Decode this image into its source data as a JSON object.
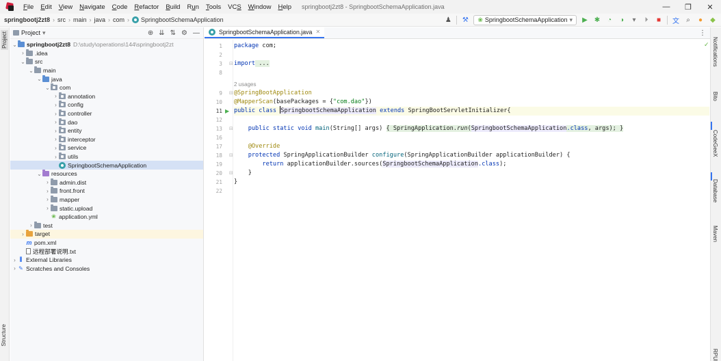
{
  "menubar": {
    "items": [
      {
        "label": "File",
        "u": "F"
      },
      {
        "label": "Edit",
        "u": "E"
      },
      {
        "label": "View",
        "u": "V"
      },
      {
        "label": "Navigate",
        "u": "N"
      },
      {
        "label": "Code",
        "u": "C"
      },
      {
        "label": "Refactor",
        "u": "R"
      },
      {
        "label": "Build",
        "u": "B"
      },
      {
        "label": "Run",
        "u": "u"
      },
      {
        "label": "Tools",
        "u": "T"
      },
      {
        "label": "VCS",
        "u": "S"
      },
      {
        "label": "Window",
        "u": "W"
      },
      {
        "label": "Help",
        "u": "H"
      }
    ],
    "window_title": "springbootj2zt8 - SpringbootSchemaApplication.java",
    "controls": {
      "minimize": "—",
      "maximize": "❐",
      "close": "✕"
    }
  },
  "navbar": {
    "crumbs": [
      "springbootj2zt8",
      "src",
      "main",
      "java",
      "com",
      "SpringbootSchemaApplication"
    ],
    "run_config": "SpringbootSchemaApplication"
  },
  "project_panel": {
    "title": "Project",
    "tree": [
      {
        "level": 0,
        "chev": "⌄",
        "icon": "mod",
        "label": "springbootj2zt8",
        "bold": true,
        "path": "D:\\study\\operations\\144\\springbootj2zt"
      },
      {
        "level": 1,
        "chev": "›",
        "icon": "plain",
        "label": ".idea"
      },
      {
        "level": 1,
        "chev": "⌄",
        "icon": "plain",
        "label": "src"
      },
      {
        "level": 2,
        "chev": "⌄",
        "icon": "plain",
        "label": "main"
      },
      {
        "level": 3,
        "chev": "⌄",
        "icon": "blue",
        "label": "java"
      },
      {
        "level": 4,
        "chev": "⌄",
        "icon": "pkg",
        "label": "com"
      },
      {
        "level": 5,
        "chev": "›",
        "icon": "pkg",
        "label": "annotation"
      },
      {
        "level": 5,
        "chev": "›",
        "icon": "pkg",
        "label": "config"
      },
      {
        "level": 5,
        "chev": "›",
        "icon": "pkg",
        "label": "controller"
      },
      {
        "level": 5,
        "chev": "›",
        "icon": "pkg",
        "label": "dao"
      },
      {
        "level": 5,
        "chev": "›",
        "icon": "pkg",
        "label": "entity"
      },
      {
        "level": 5,
        "chev": "›",
        "icon": "pkg",
        "label": "interceptor"
      },
      {
        "level": 5,
        "chev": "›",
        "icon": "pkg",
        "label": "service"
      },
      {
        "level": 5,
        "chev": "›",
        "icon": "pkg",
        "label": "utils"
      },
      {
        "level": 5,
        "chev": "",
        "icon": "class",
        "label": "SpringbootSchemaApplication",
        "selected": true
      },
      {
        "level": 3,
        "chev": "⌄",
        "icon": "res",
        "label": "resources"
      },
      {
        "level": 4,
        "chev": "›",
        "icon": "plain",
        "label": "admin.dist"
      },
      {
        "level": 4,
        "chev": "›",
        "icon": "plain",
        "label": "front.front"
      },
      {
        "level": 4,
        "chev": "›",
        "icon": "plain",
        "label": "mapper"
      },
      {
        "level": 4,
        "chev": "›",
        "icon": "plain",
        "label": "static.upload"
      },
      {
        "level": 4,
        "chev": "",
        "icon": "yml",
        "label": "application.yml"
      },
      {
        "level": 2,
        "chev": "›",
        "icon": "plain",
        "label": "test"
      },
      {
        "level": 1,
        "chev": "›",
        "icon": "orange",
        "label": "target",
        "target": true
      },
      {
        "level": 1,
        "chev": "",
        "icon": "maven",
        "label": "pom.xml"
      },
      {
        "level": 1,
        "chev": "",
        "icon": "txt",
        "label": "远程部署说明.txt"
      },
      {
        "level": 0,
        "chev": "›",
        "icon": "lib",
        "label": "External Libraries"
      },
      {
        "level": 0,
        "chev": "›",
        "icon": "scratch",
        "label": "Scratches and Consoles"
      }
    ]
  },
  "left_stripe": {
    "project_tab": "Project",
    "structure_tab": "Structure"
  },
  "right_stripe": {
    "tabs": [
      "Notifications",
      "Bito",
      "CodeGeeX",
      "Database",
      "Maven",
      "RPUN"
    ]
  },
  "editor": {
    "tab_label": "SpringbootSchemaApplication.java",
    "line_numbers": [
      "1",
      "2",
      "3",
      "8",
      "",
      "9",
      "10",
      "11",
      "12",
      "13",
      "16",
      "17",
      "18",
      "19",
      "20",
      "21",
      "22"
    ],
    "current_line": "11",
    "usages_hint": "2 usages",
    "code": {
      "l1_kw": "package",
      "l1_rest": " com;",
      "l3_kw": "import",
      "l3_fold": " ...",
      "l9_ann": "@SpringBootApplication",
      "l10_ann": "@MapperScan",
      "l10_a": "(basePackages = {",
      "l10_str": "\"com.dao\"",
      "l10_b": "})",
      "l11_kw": "public class ",
      "l11_name": "SpringbootSchemaApplication",
      "l11_kw2": " extends ",
      "l11_super": "SpringBootServletInitializer",
      "l11_brace": "{",
      "l13_kw": "    public static void ",
      "l13_fn": "main",
      "l13_a": "(String[] args) ",
      "l13_fold_a": "{ SpringApplication.",
      "l13_call": "run",
      "l13_fold_b": "(",
      "l13_cls": "SpringbootSchemaApplication",
      "l13_kw3": ".class",
      "l13_fold_c": ", args); }",
      "l17_ann": "    @Override",
      "l18_kw": "    protected ",
      "l18_a": "SpringApplicationBuilder ",
      "l18_fn": "configure",
      "l18_b": "(SpringApplicationBuilder applicationBuilder) {",
      "l19_kw": "        return ",
      "l19_a": "applicationBuilder.sources(",
      "l19_cls": "SpringbootSchemaApplication",
      "l19_kw2": ".class",
      "l19_b": ");",
      "l20": "    }",
      "l21": "}"
    }
  }
}
